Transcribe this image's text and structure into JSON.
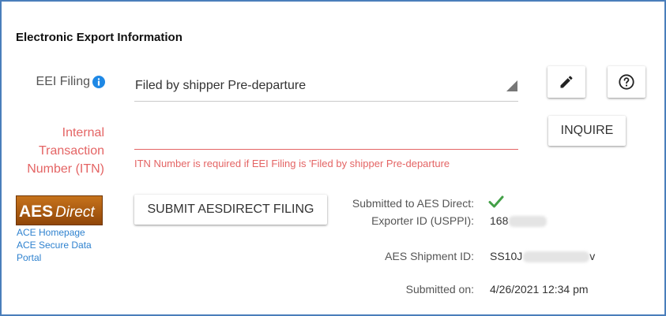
{
  "section": {
    "title": "Electronic Export Information"
  },
  "eei_filing": {
    "label": "EEI Filing",
    "info_icon": "info-icon",
    "value": "Filed by shipper Pre-departure",
    "edit_icon": "pencil-icon",
    "help_icon": "help-circle-icon"
  },
  "itn": {
    "label": "Internal Transaction Number (ITN)",
    "value": "",
    "error": "ITN Number is required if EEI Filing is 'Filed by shipper Pre-departure",
    "inquire_label": "INQUIRE"
  },
  "aes": {
    "logo_text_left": "AES",
    "logo_text_right": "Direct",
    "links": {
      "homepage": "ACE Homepage",
      "secure_data_portal": "ACE Secure Data Portal"
    },
    "submit_label": "SUBMIT AESDIRECT FILING"
  },
  "status": {
    "submitted_label": "Submitted to AES Direct:",
    "submitted_icon": "check-icon",
    "exporter_label": "Exporter ID (USPPI):",
    "exporter_value": "168",
    "shipment_label": "AES Shipment ID:",
    "shipment_value": "SS10J",
    "shipment_tail": "v",
    "submitted_on_label": "Submitted on:",
    "submitted_on_value": "4/26/2021 12:34 pm"
  },
  "colors": {
    "frame_border": "#4a7ebb",
    "error": "#e46464",
    "link": "#2f82cf",
    "check": "#43a047",
    "info_icon": "#1e88e5",
    "logo_bg": "#b35a0c"
  }
}
